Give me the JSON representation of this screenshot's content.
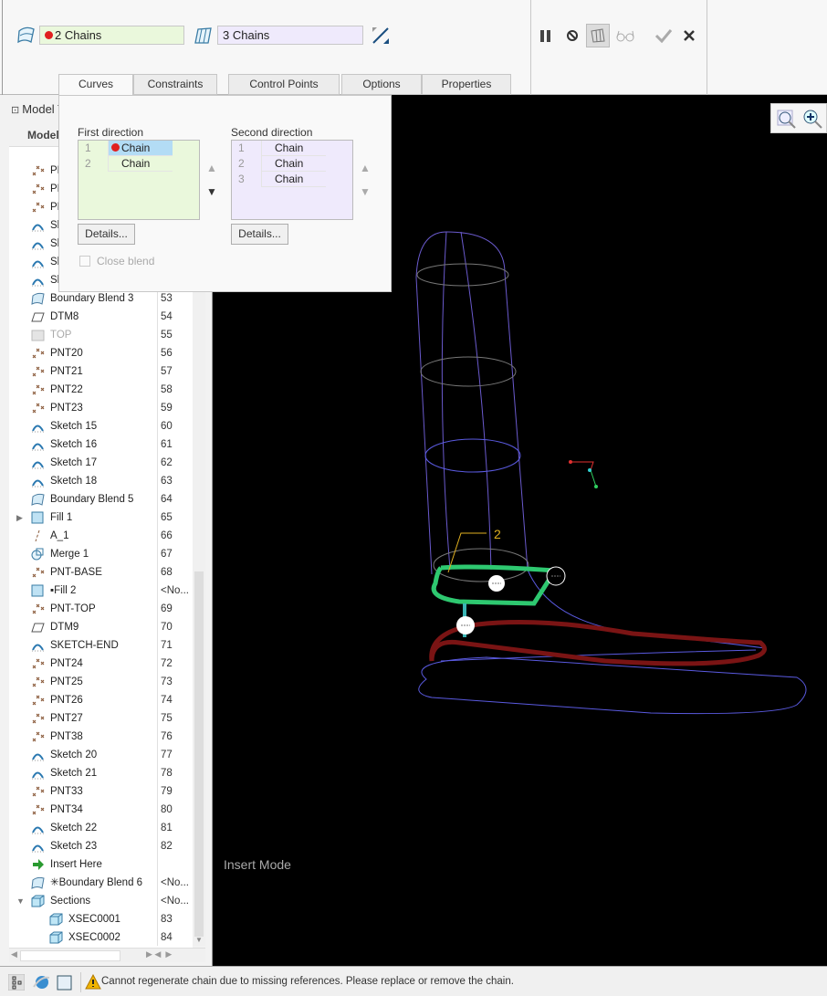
{
  "ribbon": {
    "first_chains": "2 Chains",
    "second_chains": "3 Chains"
  },
  "toolbar": {
    "pause": "pause-icon",
    "no_preview": "no-preview-icon",
    "geometry_preview": "preview-geometry-icon",
    "verify": "glasses-icon",
    "ok": "checkmark-icon",
    "cancel": "close-icon"
  },
  "tabs": [
    "Curves",
    "Constraints",
    "Control Points",
    "Options",
    "Properties"
  ],
  "curves_panel": {
    "first_direction": {
      "label": "First direction",
      "rows": [
        {
          "n": "1",
          "label": "Chain",
          "selected": true
        },
        {
          "n": "2",
          "label": "Chain"
        }
      ],
      "details": "Details..."
    },
    "second_direction": {
      "label": "Second direction",
      "rows": [
        {
          "n": "1",
          "label": "Chain"
        },
        {
          "n": "2",
          "label": "Chain"
        },
        {
          "n": "3",
          "label": "Chain"
        }
      ],
      "details": "Details..."
    },
    "close_blend": "Close blend"
  },
  "tree": {
    "header": "Model Tree",
    "column": "Model Tree",
    "items": [
      {
        "label": "PN",
        "id": "",
        "icon": "point"
      },
      {
        "label": "PN",
        "id": "",
        "icon": "point"
      },
      {
        "label": "PN",
        "id": "",
        "icon": "point"
      },
      {
        "label": "Sk",
        "id": "",
        "icon": "sketch"
      },
      {
        "label": "Sk",
        "id": "",
        "icon": "sketch"
      },
      {
        "label": "Sk",
        "id": "",
        "icon": "sketch"
      },
      {
        "label": "Sk",
        "id": "",
        "icon": "sketch"
      },
      {
        "label": "Boundary Blend 3",
        "id": "53",
        "icon": "blend"
      },
      {
        "label": "DTM8",
        "id": "54",
        "icon": "plane"
      },
      {
        "label": "TOP",
        "id": "55",
        "icon": "plane-dim"
      },
      {
        "label": "PNT20",
        "id": "56",
        "icon": "point"
      },
      {
        "label": "PNT21",
        "id": "57",
        "icon": "point"
      },
      {
        "label": "PNT22",
        "id": "58",
        "icon": "point"
      },
      {
        "label": "PNT23",
        "id": "59",
        "icon": "point"
      },
      {
        "label": "Sketch 15",
        "id": "60",
        "icon": "sketch"
      },
      {
        "label": "Sketch 16",
        "id": "61",
        "icon": "sketch"
      },
      {
        "label": "Sketch 17",
        "id": "62",
        "icon": "sketch"
      },
      {
        "label": "Sketch 18",
        "id": "63",
        "icon": "sketch"
      },
      {
        "label": "Boundary Blend 5",
        "id": "64",
        "icon": "blend"
      },
      {
        "label": "Fill 1",
        "id": "65",
        "icon": "fill",
        "expand": true
      },
      {
        "label": "A_1",
        "id": "66",
        "icon": "axis"
      },
      {
        "label": "Merge 1",
        "id": "67",
        "icon": "merge"
      },
      {
        "label": "PNT-BASE",
        "id": "68",
        "icon": "point"
      },
      {
        "label": "▪Fill 2",
        "id": "<No...",
        "icon": "fill"
      },
      {
        "label": "PNT-TOP",
        "id": "69",
        "icon": "point"
      },
      {
        "label": "DTM9",
        "id": "70",
        "icon": "plane"
      },
      {
        "label": "SKETCH-END",
        "id": "71",
        "icon": "sketch"
      },
      {
        "label": "PNT24",
        "id": "72",
        "icon": "point"
      },
      {
        "label": "PNT25",
        "id": "73",
        "icon": "point"
      },
      {
        "label": "PNT26",
        "id": "74",
        "icon": "point"
      },
      {
        "label": "PNT27",
        "id": "75",
        "icon": "point"
      },
      {
        "label": "PNT38",
        "id": "76",
        "icon": "point"
      },
      {
        "label": "Sketch 20",
        "id": "77",
        "icon": "sketch"
      },
      {
        "label": "Sketch 21",
        "id": "78",
        "icon": "sketch"
      },
      {
        "label": "PNT33",
        "id": "79",
        "icon": "point"
      },
      {
        "label": "PNT34",
        "id": "80",
        "icon": "point"
      },
      {
        "label": "Sketch 22",
        "id": "81",
        "icon": "sketch"
      },
      {
        "label": "Sketch 23",
        "id": "82",
        "icon": "sketch"
      },
      {
        "label": "Insert Here",
        "id": "",
        "icon": "insert"
      },
      {
        "label": "✳Boundary Blend 6",
        "id": "<No...",
        "icon": "blend"
      },
      {
        "label": "Sections",
        "id": "<No...",
        "icon": "section",
        "collapse": true
      },
      {
        "label": "XSEC0001",
        "id": "83",
        "icon": "section",
        "indent": true
      },
      {
        "label": "XSEC0002",
        "id": "84",
        "icon": "section",
        "indent": true
      }
    ]
  },
  "viewport": {
    "mode": "Insert Mode",
    "dimension_label": "2"
  },
  "status": {
    "message": "Cannot regenerate chain due to missing references. Please replace or remove the chain."
  },
  "colors": {
    "first_dir": "#eaf8dc",
    "second_dir": "#efeafc",
    "selected": "#b3dcf5",
    "green_chain": "#2ec870",
    "red_chain": "#7a1414",
    "wire": "#5a5ae0"
  }
}
